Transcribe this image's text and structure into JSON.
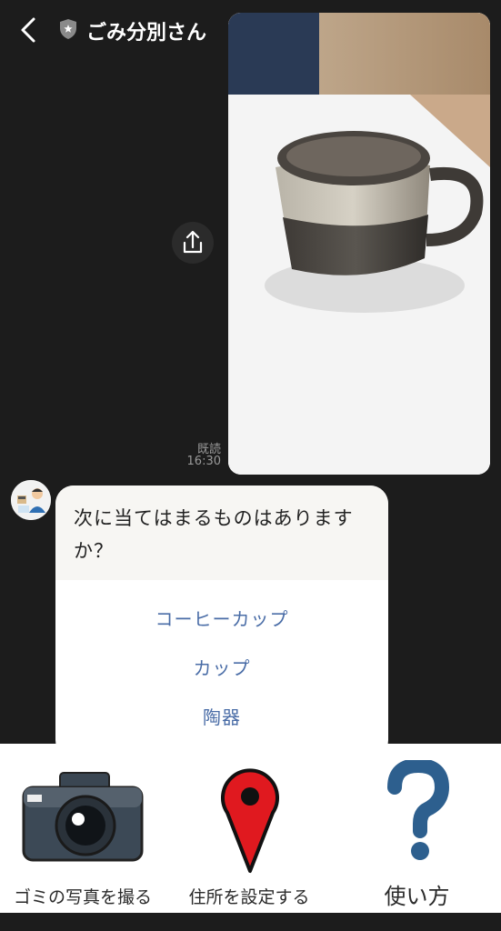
{
  "header": {
    "title": "ごみ分別さん"
  },
  "chat": {
    "sent": {
      "read_label": "既読",
      "time": "16:30"
    },
    "bot": {
      "question": "次に当てはまるものはありますか？",
      "choices": [
        "コーヒーカップ",
        "カップ",
        "陶器"
      ]
    }
  },
  "rich_menu": {
    "items": [
      {
        "label": "ゴミの写真を撮る",
        "icon": "camera-icon"
      },
      {
        "label": "住所を設定する",
        "icon": "map-pin-icon"
      },
      {
        "label": "使い方",
        "icon": "question-mark-icon"
      }
    ]
  },
  "colors": {
    "background": "#1c1c1c",
    "choice_text": "#4a6da7",
    "pin_red": "#e0191f",
    "question_blue": "#2d5f8e"
  }
}
